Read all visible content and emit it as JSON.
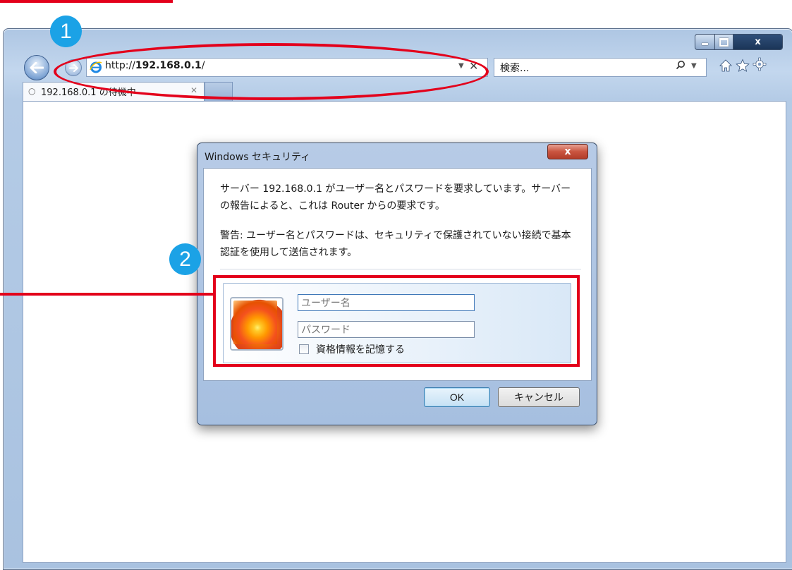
{
  "browser": {
    "address_prefix": "http://",
    "address_host": "192.168.0.1",
    "address_suffix": "/",
    "search_placeholder": "検索...",
    "tab_title": "192.168.0.1 の待機中",
    "window_controls": {
      "minimize": "minimize",
      "maximize": "maximize",
      "close": "x"
    }
  },
  "callouts": {
    "one": "1",
    "two": "2"
  },
  "dialog": {
    "title": "Windows セキュリティ",
    "message": "サーバー 192.168.0.1 がユーザー名とパスワードを要求しています。サーバーの報告によると、これは Router からの要求です。",
    "warning": "警告: ユーザー名とパスワードは、セキュリティで保護されていない接続で基本認証を使用して送信されます。",
    "username_placeholder": "ユーザー名",
    "password_placeholder": "パスワード",
    "remember_label": "資格情報を記憶する",
    "ok_label": "OK",
    "cancel_label": "キャンセル"
  },
  "colors": {
    "callout_red": "#e3001b",
    "badge_blue": "#1ba2e6"
  },
  "icons": [
    "back-arrow-icon",
    "forward-arrow-icon",
    "ie-logo-icon",
    "search-icon",
    "home-icon",
    "favorites-star-icon",
    "settings-gear-icon",
    "close-icon",
    "user-tile-flower-icon"
  ]
}
